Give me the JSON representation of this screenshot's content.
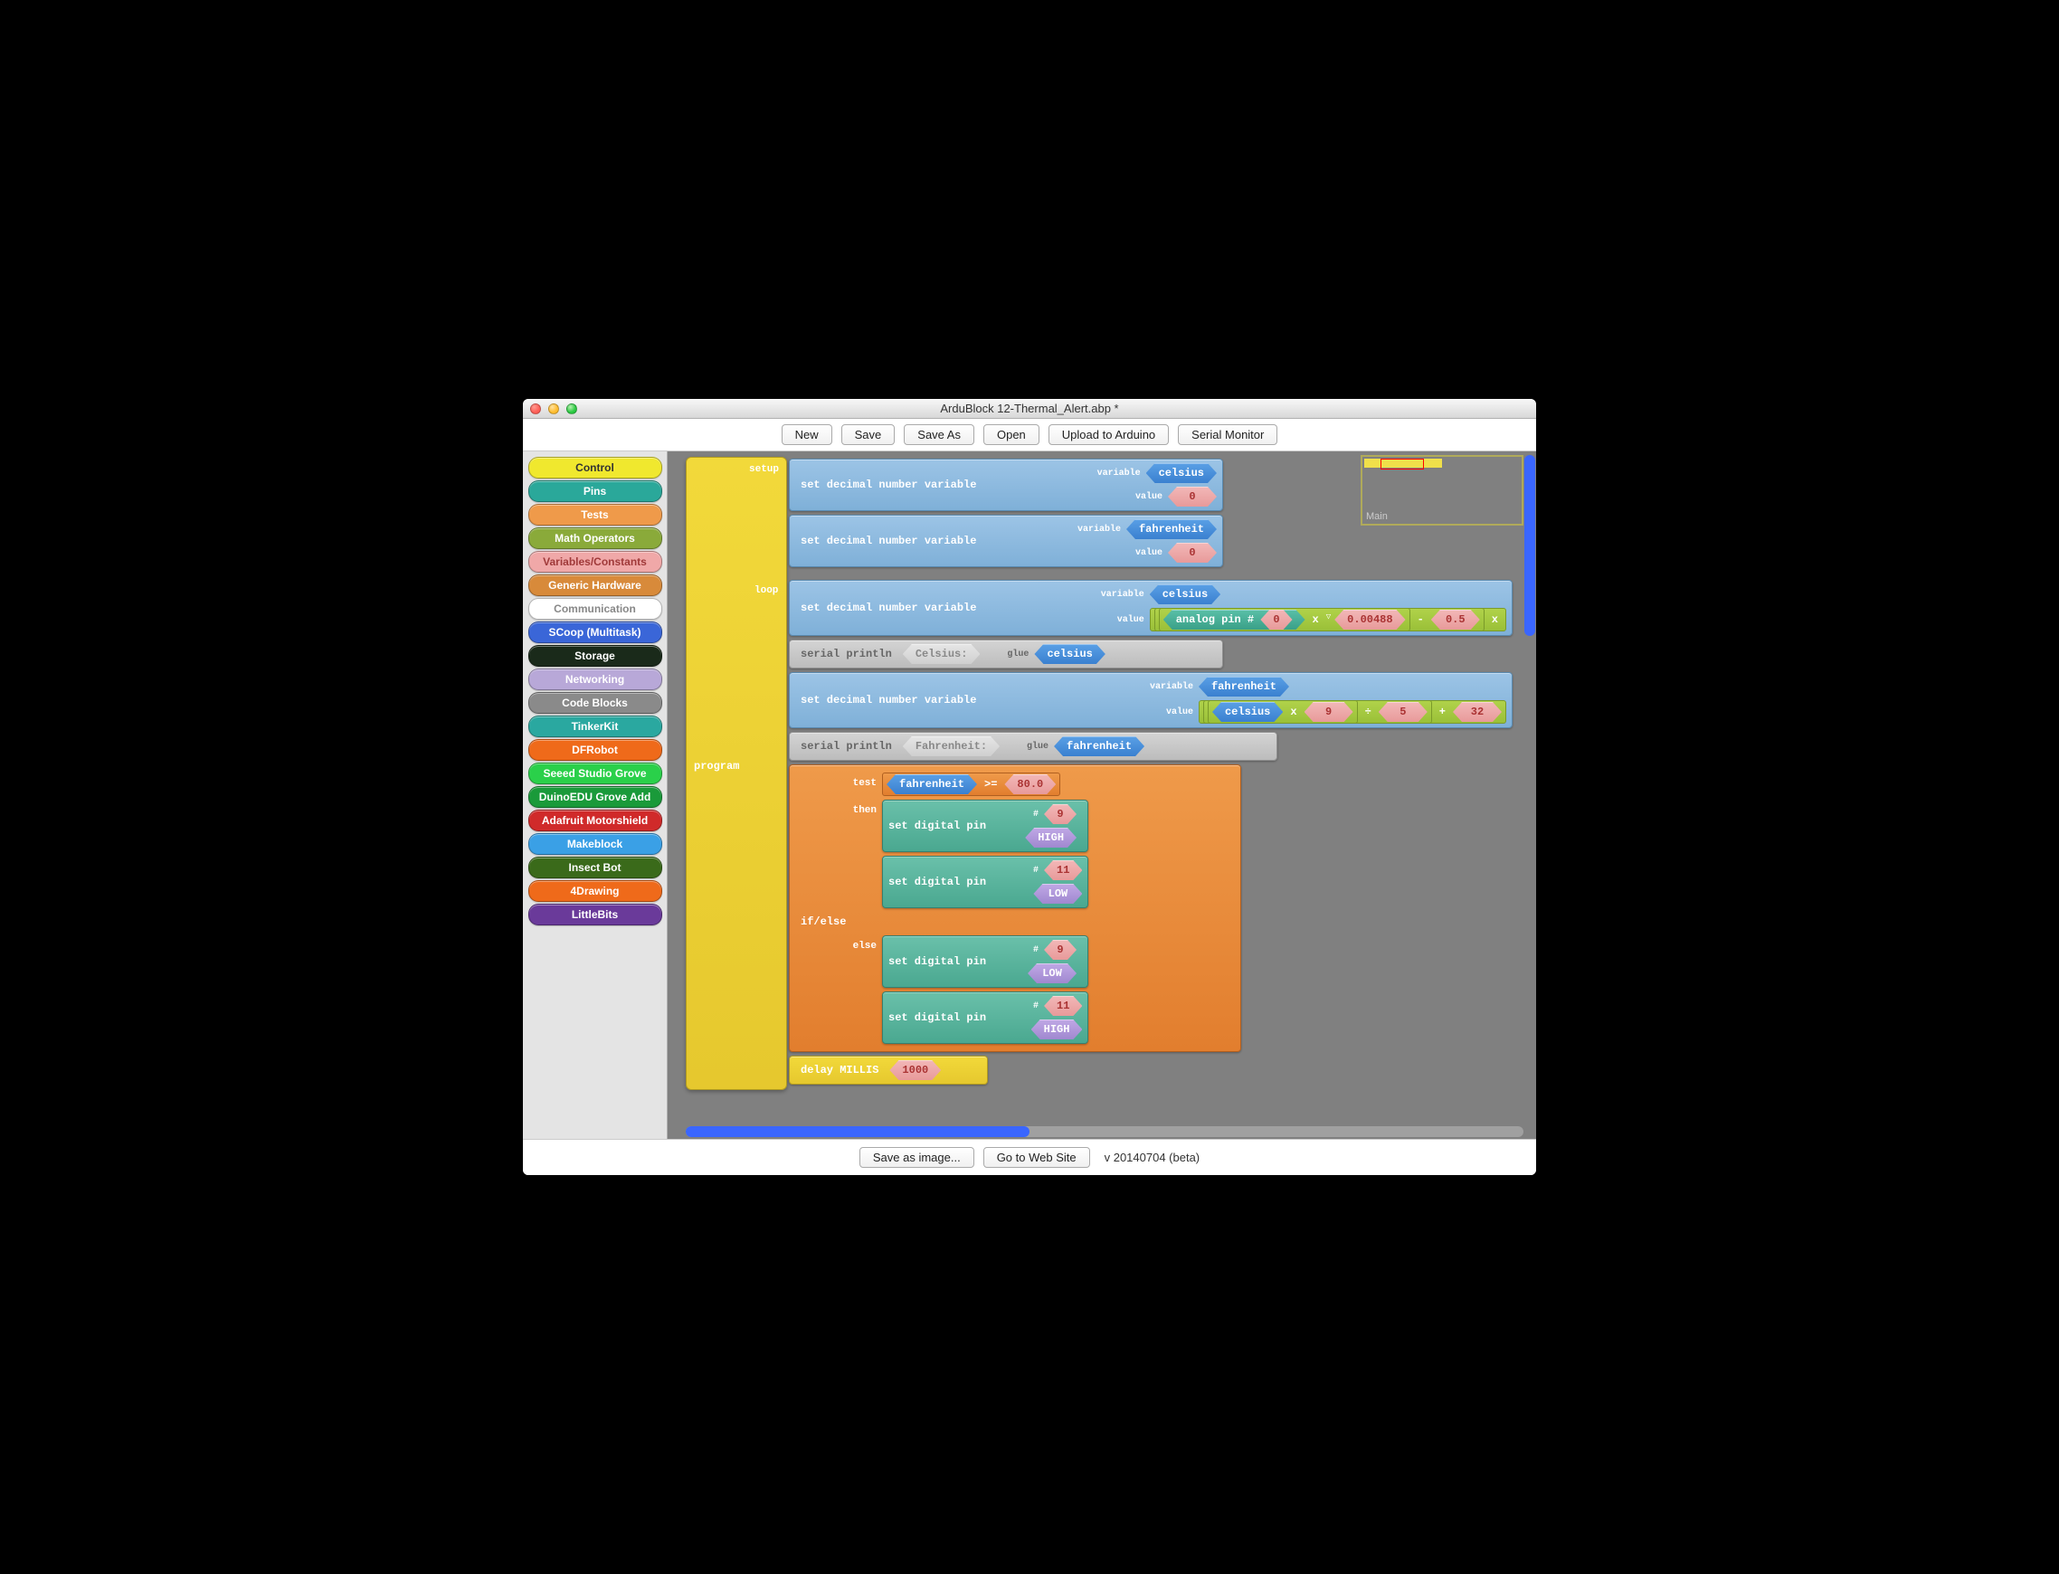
{
  "window": {
    "title": "ArduBlock 12-Thermal_Alert.abp *"
  },
  "toolbar": {
    "new": "New",
    "save": "Save",
    "saveas": "Save As",
    "open": "Open",
    "upload": "Upload to Arduino",
    "serial": "Serial Monitor"
  },
  "palette": [
    {
      "label": "Control",
      "bg": "#f0e82e",
      "fg": "#333"
    },
    {
      "label": "Pins",
      "bg": "#2aa89a",
      "fg": "#fff"
    },
    {
      "label": "Tests",
      "bg": "#ef9a4a",
      "fg": "#fff"
    },
    {
      "label": "Math Operators",
      "bg": "#8aaa3a",
      "fg": "#fff"
    },
    {
      "label": "Variables/Constants",
      "bg": "#f0a8a8",
      "fg": "#a03a3a"
    },
    {
      "label": "Generic Hardware",
      "bg": "#d88a3a",
      "fg": "#fff"
    },
    {
      "label": "Communication",
      "bg": "#ffffff",
      "fg": "#888"
    },
    {
      "label": "SCoop (Multitask)",
      "bg": "#3a66d8",
      "fg": "#fff"
    },
    {
      "label": "Storage",
      "bg": "#1a2a1a",
      "fg": "#fff"
    },
    {
      "label": "Networking",
      "bg": "#b8a8d8",
      "fg": "#fff"
    },
    {
      "label": "Code Blocks",
      "bg": "#8a8a8a",
      "fg": "#fff"
    },
    {
      "label": "TinkerKit",
      "bg": "#2aa8a0",
      "fg": "#fff"
    },
    {
      "label": "DFRobot",
      "bg": "#ef6a1a",
      "fg": "#fff"
    },
    {
      "label": "Seeed Studio Grove",
      "bg": "#2ad04a",
      "fg": "#fff"
    },
    {
      "label": "DuinoEDU Grove Add",
      "bg": "#1a9a3a",
      "fg": "#fff"
    },
    {
      "label": "Adafruit Motorshield",
      "bg": "#d02a2a",
      "fg": "#fff"
    },
    {
      "label": "Makeblock",
      "bg": "#3aa0e6",
      "fg": "#fff"
    },
    {
      "label": "Insect Bot",
      "bg": "#3a6a1a",
      "fg": "#fff"
    },
    {
      "label": "4Drawing",
      "bg": "#ef6a1a",
      "fg": "#fff"
    },
    {
      "label": "LittleBits",
      "bg": "#6a3a9a",
      "fg": "#fff"
    }
  ],
  "blocks": {
    "program": "program",
    "setup": "setup",
    "loop": "loop",
    "setdec": "set decimal number variable",
    "variable": "variable",
    "value": "value",
    "celsius": "celsius",
    "fahrenheit": "fahrenheit",
    "zero": "0",
    "serialp": "serial println",
    "msg_cel": "Celsius:",
    "msg_fah": "Fahrenheit:",
    "glue": "glue",
    "analogpin": "analog pin #",
    "pin0": "0",
    "mult": "x",
    "coef": "0.00488",
    "minus": "-",
    "half": "0.5",
    "xtrail": "x",
    "nine": "9",
    "div": "÷",
    "five": "5",
    "plus": "+",
    "thirtytwo": "32",
    "ifelse": "if/else",
    "test": "test",
    "then": "then",
    "else": "else",
    "gte": ">=",
    "eighty": "80.0",
    "setdig": "set digital pin",
    "hash": "#",
    "p9": "9",
    "p11": "11",
    "high": "HIGH",
    "low": "LOW",
    "delay": "delay MILLIS",
    "thousand": "1000"
  },
  "minimap": {
    "label": "Main"
  },
  "footer": {
    "saveimg": "Save as image...",
    "gotoweb": "Go to Web Site",
    "version": "v 20140704 (beta)"
  }
}
